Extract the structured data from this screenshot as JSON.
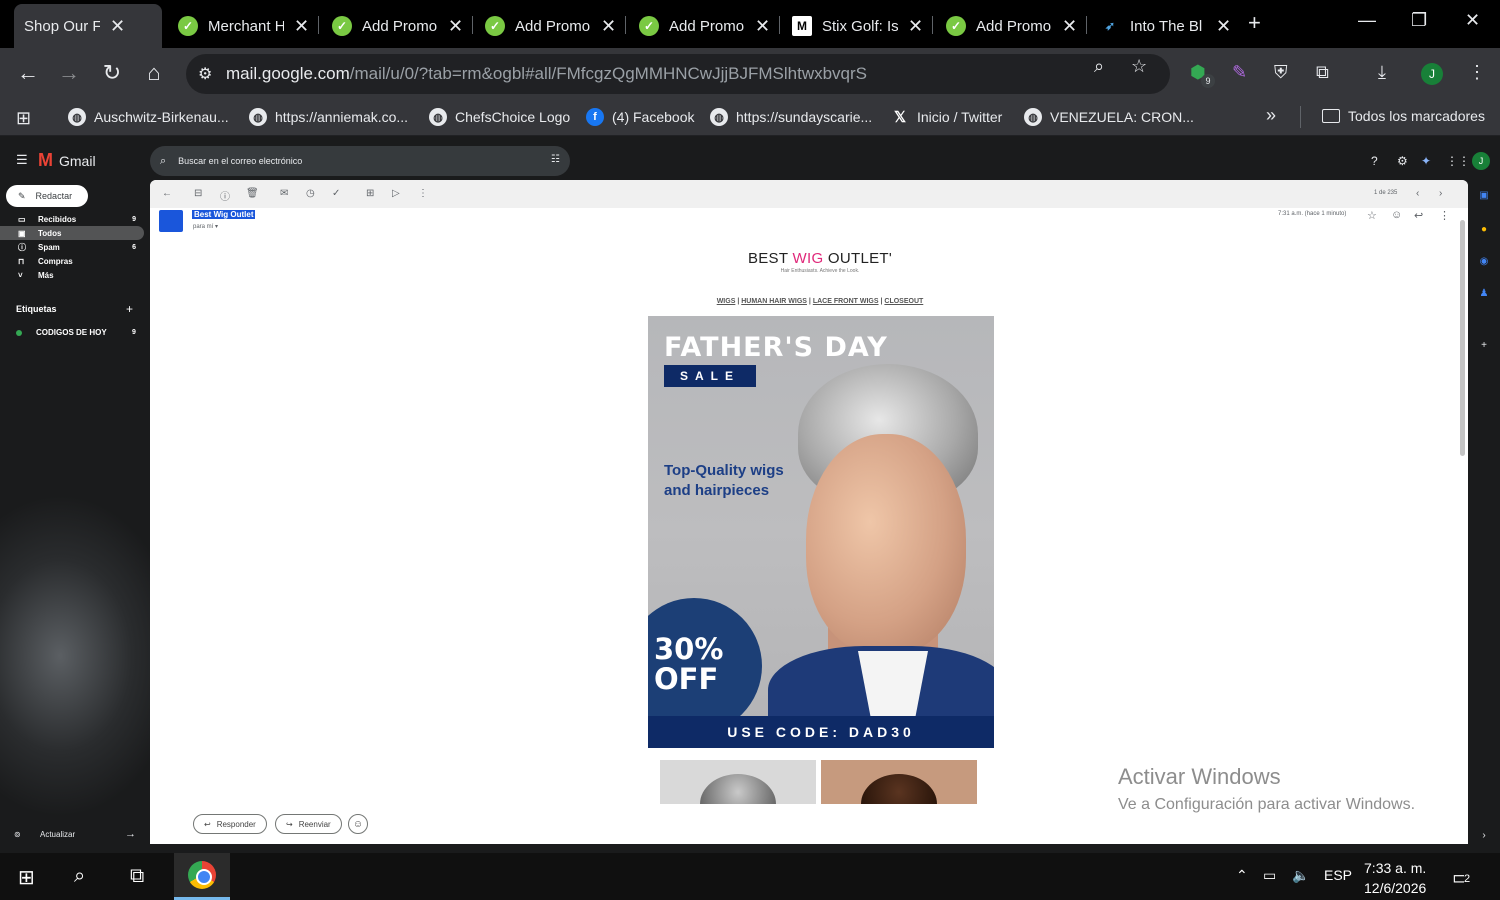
{
  "tabs": [
    {
      "title": "Shop Our F",
      "icon": "gmail-icon",
      "active": true
    },
    {
      "title": "Merchant H",
      "icon": "checkmark-icon"
    },
    {
      "title": "Add Promo",
      "icon": "checkmark-icon"
    },
    {
      "title": "Add Promo",
      "icon": "checkmark-icon"
    },
    {
      "title": "Add Promo",
      "icon": "checkmark-icon"
    },
    {
      "title": "Stix Golf: Is",
      "icon": "m-logo-icon"
    },
    {
      "title": "Add Promo",
      "icon": "checkmark-icon"
    },
    {
      "title": "Into The Bl",
      "icon": "bird-icon"
    }
  ],
  "address": {
    "domain": "mail.google.com",
    "path": "/mail/u/0/?tab=rm&ogbl#all/FMfcgzQgMMHNCwJjjBJFMSlhtwxbvqrS"
  },
  "extensions_badge": "9",
  "profile_initial": "J",
  "bookmarks": [
    {
      "label": "Auschwitz-Birkenau..."
    },
    {
      "label": "https://anniemak.co..."
    },
    {
      "label": "ChefsChoice Logo"
    },
    {
      "label": "(4) Facebook"
    },
    {
      "label": "https://sundayscarie..."
    },
    {
      "label": "Inicio / Twitter"
    },
    {
      "label": "VENEZUELA: CRON..."
    }
  ],
  "bookmarks_more": "»",
  "all_bookmarks": "Todos los marcadores",
  "gmail": {
    "app_name": "Gmail",
    "search_placeholder": "Buscar en el correo electrónico",
    "compose": "Redactar",
    "nav": [
      {
        "label": "Recibidos",
        "count": "9"
      },
      {
        "label": "Todos",
        "count": ""
      },
      {
        "label": "Spam",
        "count": "6"
      },
      {
        "label": "Compras",
        "count": ""
      },
      {
        "label": "Más",
        "count": ""
      }
    ],
    "labels_heading": "Etiquetas",
    "label_items": [
      {
        "label": "CODIGOS DE HOY",
        "count": "9"
      }
    ],
    "update": "Actualizar",
    "pagination": "1 de 235",
    "sender": "Best Wig Outlet",
    "to_me": "para mí",
    "time": "7:31 a.m. (hace 1 minuto)"
  },
  "email": {
    "brand_part1": "BEST ",
    "brand_part2": "WIG",
    "brand_part3": " OUTLET",
    "tagline": "Hair Enthusiasts. Achieve the Look.",
    "menu": [
      "WIGS",
      "HUMAN HAIR WIGS",
      "LACE FRONT WIGS",
      "CLOSEOUT"
    ],
    "menu_sep": " | ",
    "banner_title": "FATHER'S DAY",
    "banner_sale": "SALE",
    "banner_sub": "Top-Quality wigs and hairpieces",
    "banner_off_1": "30%",
    "banner_off_2": "OFF",
    "banner_code": "USE CODE: DAD30",
    "reply": "Responder",
    "forward": "Reenviar"
  },
  "watermark": {
    "line1": "Activar Windows",
    "line2": "Ve a Configuración para activar Windows."
  },
  "taskbar": {
    "lang": "ESP",
    "time": "7:33 a. m.",
    "date": "12/6/2026",
    "notifications": "2"
  },
  "colors": {
    "brand_accent": "#e0287a",
    "banner_navy": "#0e2a66",
    "gmail_red": "#ea4335"
  }
}
